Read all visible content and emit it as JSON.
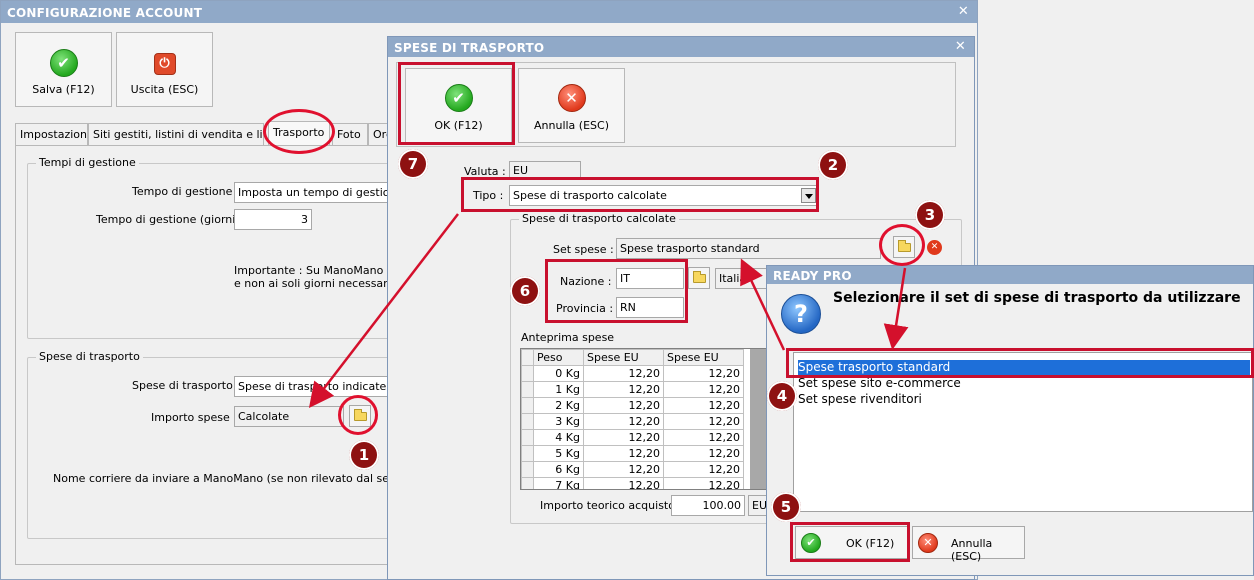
{
  "main_window": {
    "title": "CONFIGURAZIONE ACCOUNT",
    "close": "✕",
    "toolbar": {
      "save_label": "Salva (F12)",
      "exit_label": "Uscita (ESC)"
    },
    "tabs": [
      "Impostazioni",
      "Siti gestiti, listini di vendita e lingue",
      "Trasporto",
      "Foto",
      "Ord"
    ],
    "tempi": {
      "group_title": "Tempi di gestione",
      "tempo_label": "Tempo di gestione :",
      "tempo_value": "Imposta un tempo di gestione f",
      "giorni_label": "Tempo di gestione (giorni) :",
      "giorni_value": "3",
      "note_line1": "Importante : Su ManoMano que",
      "note_line2": "e non ai soli giorni necessari per"
    },
    "spese": {
      "group_title": "Spese di trasporto",
      "spese_label": "Spese di trasporto :",
      "spese_value": "Spese di trasporto indicate sep",
      "importo_label": "Importo spese :",
      "importo_value": "Calcolate",
      "corriere_note": "Nome corriere da inviare a ManoMano (se non rilevato dal set di spese"
    }
  },
  "spese_dialog": {
    "title": "SPESE DI TRASPORTO",
    "close": "✕",
    "ok_label": "OK (F12)",
    "cancel_label": "Annulla (ESC)",
    "valuta_label": "Valuta :",
    "valuta_value": "EU",
    "tipo_label": "Tipo :",
    "tipo_value": "Spese di trasporto calcolate",
    "group_title": "Spese di trasporto calcolate",
    "set_label": "Set spese :",
    "set_value": "Spese trasporto standard",
    "nazione_label": "Nazione :",
    "nazione_value": "IT",
    "nazione_name": "Italia",
    "provincia_label": "Provincia :",
    "provincia_value": "RN",
    "anteprima_label": "Anteprima spese",
    "table": {
      "headers": [
        "Peso",
        "Spese EU",
        "Spese EU"
      ],
      "rows": [
        [
          "0 Kg",
          "12,20",
          "12,20"
        ],
        [
          "1 Kg",
          "12,20",
          "12,20"
        ],
        [
          "2 Kg",
          "12,20",
          "12,20"
        ],
        [
          "3 Kg",
          "12,20",
          "12,20"
        ],
        [
          "4 Kg",
          "12,20",
          "12,20"
        ],
        [
          "5 Kg",
          "12,20",
          "12,20"
        ],
        [
          "6 Kg",
          "12,20",
          "12,20"
        ],
        [
          "7 Kg",
          "12,20",
          "12,20"
        ]
      ]
    },
    "importo_label": "Importo teorico acquisto:",
    "importo_value": "100.00",
    "importo_currency": "EU"
  },
  "ready_dialog": {
    "title": "READY PRO",
    "question_glyph": "?",
    "message": "Selezionare il set di spese di trasporto da utilizzare",
    "options": [
      "Spese trasporto standard",
      "Set spese sito e-commerce",
      "Set spese rivenditori"
    ],
    "selected_index": 0,
    "ok_label": "OK (F12)",
    "cancel_label": "Annulla (ESC)"
  },
  "badges": [
    "1",
    "2",
    "3",
    "4",
    "5",
    "6",
    "7"
  ],
  "colors": {
    "titlebar": "#90a9c8",
    "highlight_red": "#c8102e",
    "badge": "#8e1111",
    "selection": "#1e6fd9"
  },
  "icons": {
    "ok": "check-circle-icon",
    "cancel": "x-circle-icon",
    "exit": "power-icon",
    "folder": "folder-icon",
    "question": "question-icon"
  }
}
